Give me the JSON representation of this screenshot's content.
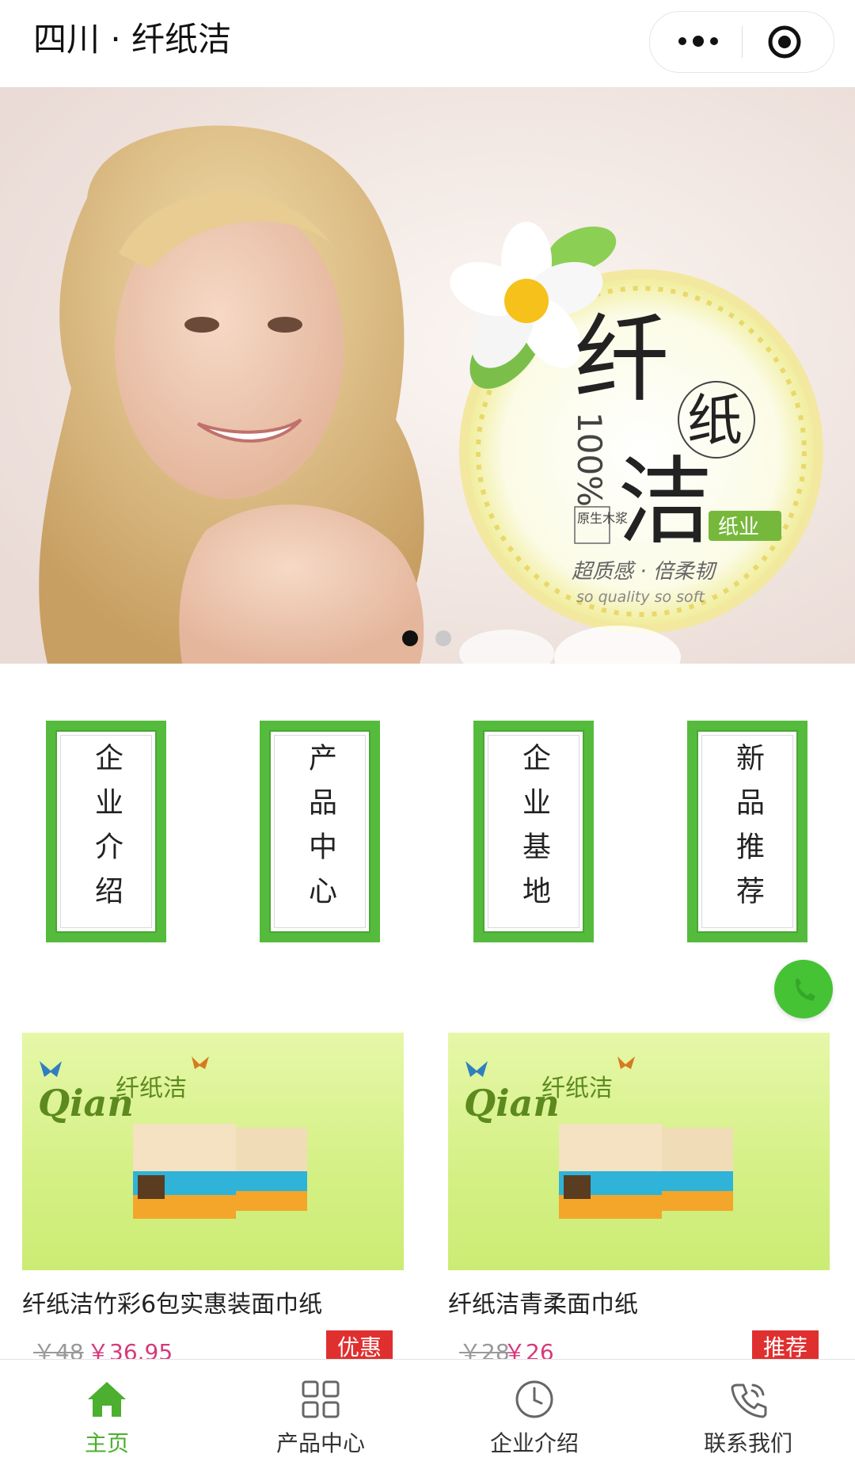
{
  "header": {
    "title": "四川 · 纤纸洁"
  },
  "banner": {
    "logo_big_1": "纤",
    "logo_circle": "纸",
    "logo_big_2": "洁",
    "pulp_percent": "100%",
    "pulp_text": "原生木浆",
    "badge": "纸业",
    "slogan_cn": "超质感 · 倍柔韧",
    "slogan_en": "so quality so soft",
    "slides_total": 2,
    "active_slide": 1
  },
  "quick_nav": [
    {
      "label": "企业介绍"
    },
    {
      "label": "产品中心"
    },
    {
      "label": "企业基地"
    },
    {
      "label": "新品推荐"
    }
  ],
  "products": [
    {
      "name": "纤纸洁竹彩6包实惠装面巾纸",
      "old_price": "￥48",
      "price": "￥36.95",
      "tag": "优惠",
      "brand_text": "纤纸洁"
    },
    {
      "name": "纤纸洁青柔面巾纸",
      "old_price": "￥28",
      "price": "￥26",
      "tag": "推荐",
      "brand_text": "纤纸洁"
    }
  ],
  "tabs": [
    {
      "label": "主页",
      "icon": "home-icon"
    },
    {
      "label": "产品中心",
      "icon": "grid-icon"
    },
    {
      "label": "企业介绍",
      "icon": "clock-icon"
    },
    {
      "label": "联系我们",
      "icon": "phone-icon"
    }
  ],
  "colors": {
    "accent": "#55bb3c",
    "price": "#d6397b",
    "tag": "#e02f2f",
    "active_tab": "#4caf2f"
  }
}
